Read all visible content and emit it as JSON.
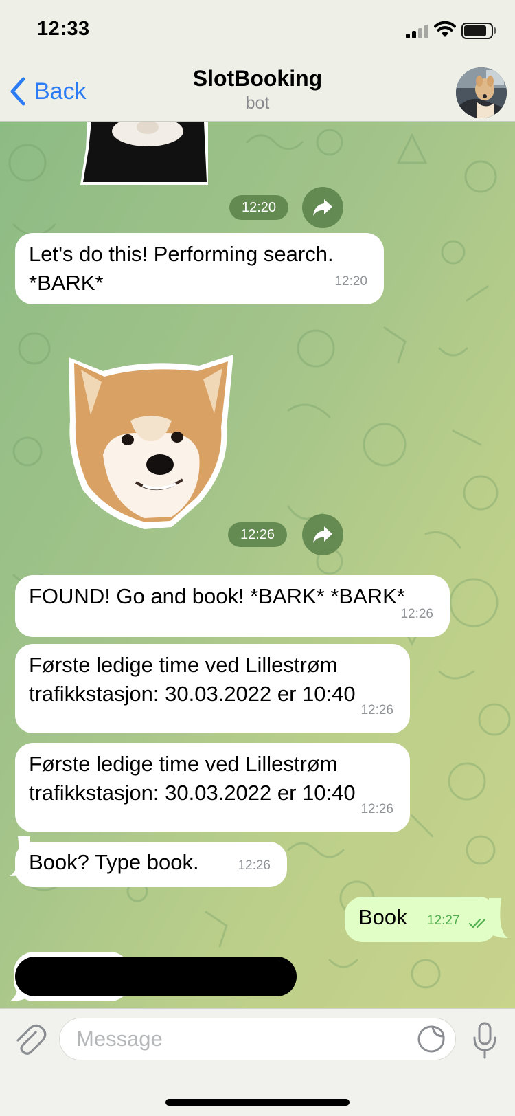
{
  "status_bar": {
    "time": "12:33"
  },
  "header": {
    "back_label": "Back",
    "title": "SlotBooking",
    "subtitle": "bot"
  },
  "messages": [
    {
      "type": "sticker",
      "name": "partial-dog-sticker",
      "time": "12:20"
    },
    {
      "type": "text",
      "direction": "in",
      "lines": [
        "Let's do this! Performing search.",
        "*BARK*"
      ],
      "time": "12:20"
    },
    {
      "type": "sticker",
      "name": "shiba-dog-sticker",
      "time": "12:26"
    },
    {
      "type": "text",
      "direction": "in",
      "lines": [
        "FOUND! Go and book! *BARK* *BARK*"
      ],
      "time": "12:26"
    },
    {
      "type": "text",
      "direction": "in",
      "lines": [
        "Første ledige time ved Lillestrøm",
        "trafikkstasjon: 30.03.2022 er 10:40"
      ],
      "time": "12:26"
    },
    {
      "type": "text",
      "direction": "in",
      "lines": [
        "Første ledige time ved Lillestrøm",
        "trafikkstasjon: 30.03.2022 er 10:40"
      ],
      "time": "12:26"
    },
    {
      "type": "text",
      "direction": "in",
      "lines": [
        "Book? Type book."
      ],
      "time": "12:26"
    },
    {
      "type": "text",
      "direction": "out",
      "lines": [
        "Book"
      ],
      "time": "12:27",
      "status": "read"
    },
    {
      "type": "redacted",
      "direction": "in"
    }
  ],
  "input": {
    "placeholder": "Message"
  },
  "icons": {
    "back": "chevron-left-icon",
    "attach": "paperclip-icon",
    "sticker": "sticker-icon",
    "mic": "microphone-icon",
    "share": "share-arrow-icon",
    "read": "double-check-icon"
  },
  "colors": {
    "accent": "#2c7cf6",
    "incoming_bubble": "#ffffff",
    "outgoing_bubble": "#e1fec6",
    "outgoing_time": "#4fae4e",
    "chat_bg_start": "#8dbb84",
    "chat_bg_end": "#c8d38c"
  }
}
